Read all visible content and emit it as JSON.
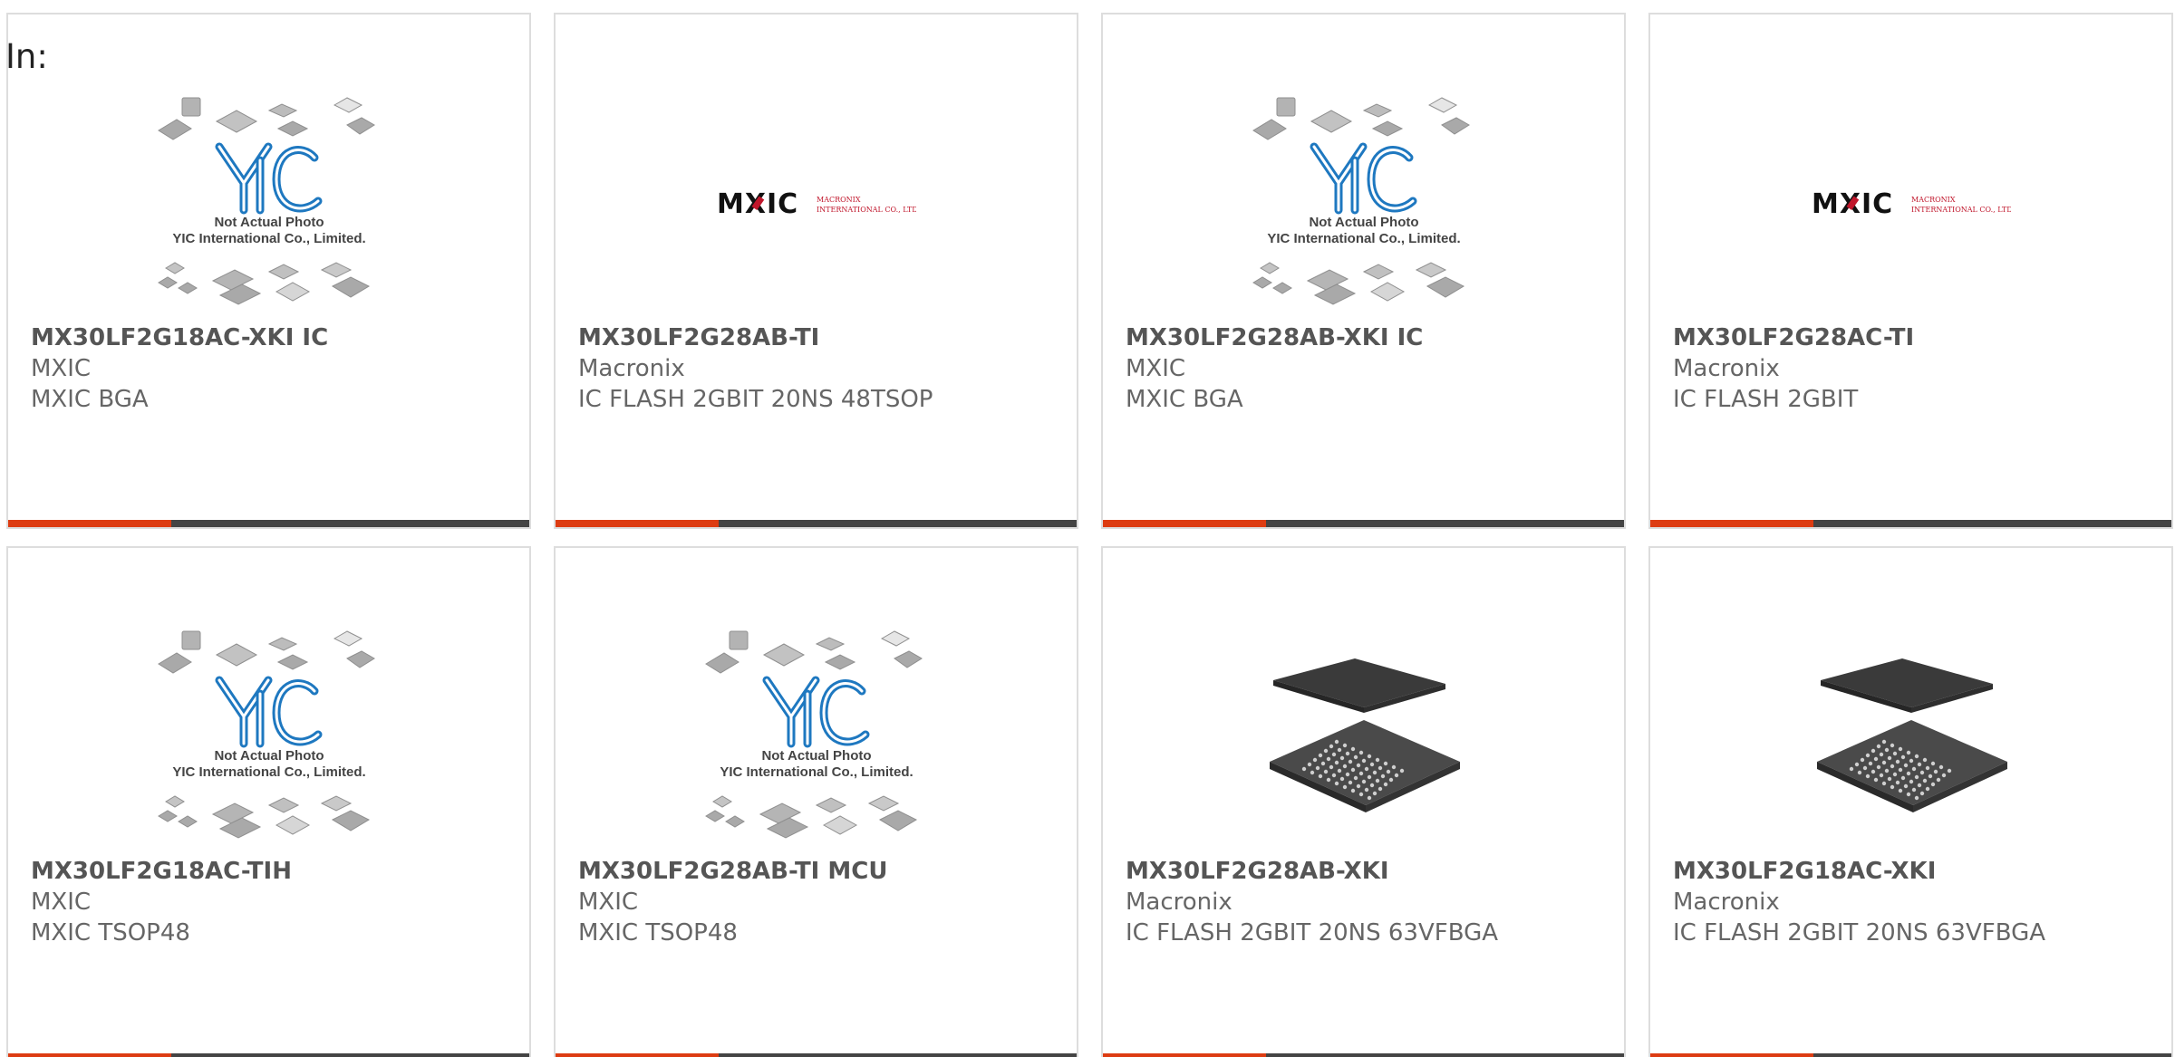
{
  "filter_label": "In:",
  "colors": {
    "accent": "#dd3c12",
    "bar": "#444444",
    "yic_blue": "#1e78c0",
    "mxic_red": "#c0162b"
  },
  "placeholder": {
    "caption_line1": "Not Actual Photo",
    "caption_line2": "YIC International Co., Limited.",
    "logo_text": "YIC"
  },
  "mxic_logo": {
    "wordmark": "MXIC",
    "tagline_line1": "MACRONIX",
    "tagline_line2": "INTERNATIONAL CO., LTD."
  },
  "products": [
    {
      "part": "MX30LF2G18AC-XKI IC",
      "maker": "MXIC",
      "desc": "MXIC BGA",
      "image": "yic-placeholder"
    },
    {
      "part": "MX30LF2G28AB-TI",
      "maker": "Macronix",
      "desc": "IC FLASH 2GBIT 20NS 48TSOP",
      "image": "mxic-logo"
    },
    {
      "part": "MX30LF2G28AB-XKI IC",
      "maker": "MXIC",
      "desc": "MXIC BGA",
      "image": "yic-placeholder"
    },
    {
      "part": "MX30LF2G28AC-TI",
      "maker": "Macronix",
      "desc": "IC FLASH 2GBIT",
      "image": "mxic-logo"
    },
    {
      "part": "MX30LF2G18AC-TIH",
      "maker": "MXIC",
      "desc": "MXIC TSOP48",
      "image": "yic-placeholder"
    },
    {
      "part": "MX30LF2G28AB-TI MCU",
      "maker": "MXIC",
      "desc": "MXIC TSOP48",
      "image": "yic-placeholder"
    },
    {
      "part": "MX30LF2G28AB-XKI",
      "maker": "Macronix",
      "desc": "IC FLASH 2GBIT 20NS 63VFBGA",
      "image": "bga-chip-photo"
    },
    {
      "part": "MX30LF2G18AC-XKI",
      "maker": "Macronix",
      "desc": "IC FLASH 2GBIT 20NS 63VFBGA",
      "image": "bga-chip-photo"
    }
  ]
}
